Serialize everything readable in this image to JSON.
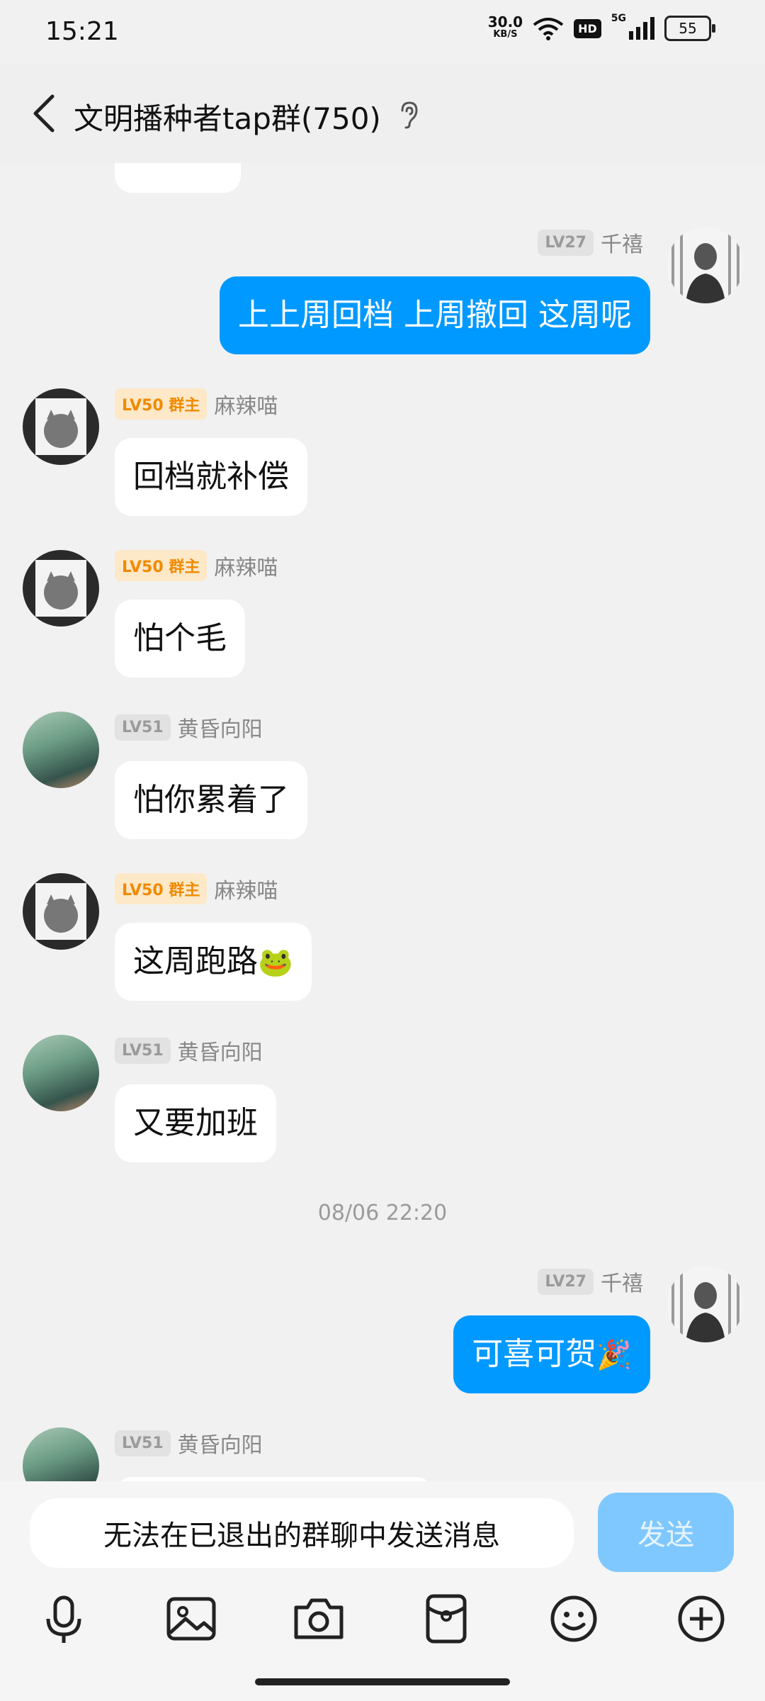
{
  "status": {
    "time": "15:21",
    "net_speed": "30.0",
    "net_unit": "KB/S",
    "hd": "HD",
    "signal": "5G",
    "battery": "55"
  },
  "header": {
    "title": "文明播种者tap群(750)"
  },
  "messages": [
    {
      "side": "out",
      "level": "LV27",
      "name": "千禧",
      "text": "上上周回档 上周撤回 这周呢"
    },
    {
      "side": "in",
      "level": "LV50",
      "role": "群主",
      "name": "麻辣喵",
      "text": "回档就补偿"
    },
    {
      "side": "in",
      "level": "LV50",
      "role": "群主",
      "name": "麻辣喵",
      "text": "怕个毛"
    },
    {
      "side": "in",
      "level": "LV51",
      "name": "黄昏向阳",
      "text": "怕你累着了"
    },
    {
      "side": "in",
      "level": "LV50",
      "role": "群主",
      "name": "麻辣喵",
      "text": "这周跑路",
      "emoji": "🐸"
    },
    {
      "side": "in",
      "level": "LV51",
      "name": "黄昏向阳",
      "text": "又要加班"
    },
    {
      "side": "out",
      "level": "LV27",
      "name": "千禧",
      "text": "可喜可贺",
      "emoji": "🎉"
    },
    {
      "side": "in",
      "level": "LV51",
      "name": "黄昏向阳",
      "text": ""
    }
  ],
  "timestamp": "08/06 22:20",
  "input": {
    "text": "无法在已退出的群聊中发送消息",
    "send_label": "发送"
  },
  "toolbar": [
    "mic-icon",
    "image-icon",
    "camera-icon",
    "red-packet-icon",
    "emoji-icon",
    "plus-icon"
  ],
  "colors": {
    "bubble_out": "#0099ff",
    "bubble_in": "#ffffff",
    "owner_badge": "#f08a00",
    "send_disabled": "#7fc8ff"
  }
}
